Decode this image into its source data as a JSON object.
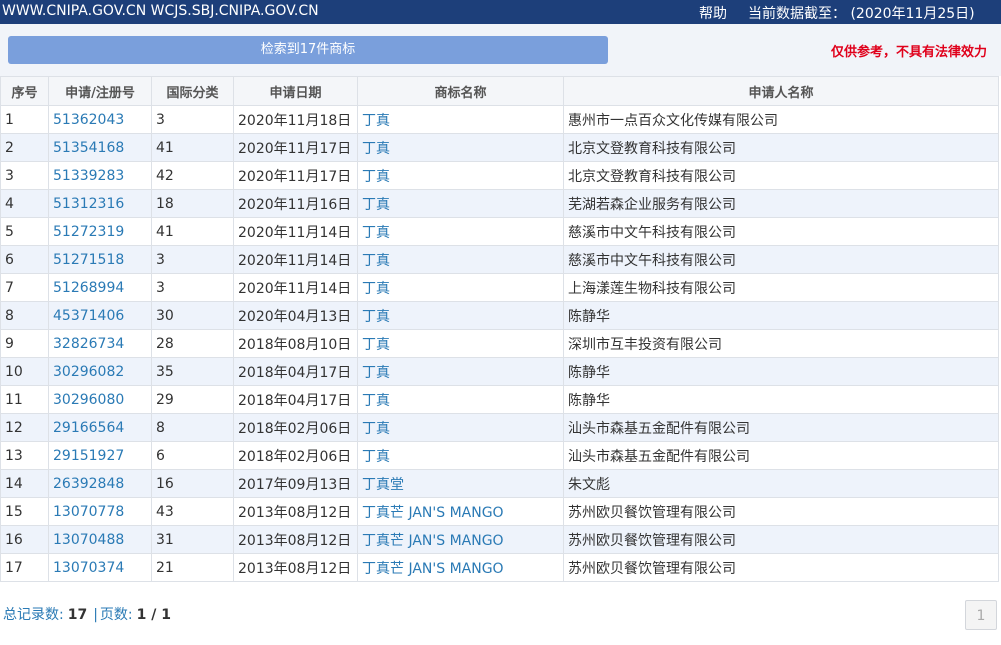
{
  "topbar": {
    "domains": "WWW.CNIPA.GOV.CN WCJS.SBJ.CNIPA.GOV.CN",
    "help": "帮助",
    "data_as_of": "当前数据截至： (2020年11月25日)"
  },
  "search": {
    "result_label": "检索到17件商标",
    "disclaimer": "仅供参考，不具有法律效力"
  },
  "table": {
    "headers": [
      "序号",
      "申请/注册号",
      "国际分类",
      "申请日期",
      "商标名称",
      "申请人名称"
    ],
    "rows": [
      {
        "no": "1",
        "reg": "51362043",
        "cls": "3",
        "date": "2020年11月18日",
        "mark": "丁真",
        "applicant": "惠州市一点百众文化传媒有限公司"
      },
      {
        "no": "2",
        "reg": "51354168",
        "cls": "41",
        "date": "2020年11月17日",
        "mark": "丁真",
        "applicant": "北京文登教育科技有限公司"
      },
      {
        "no": "3",
        "reg": "51339283",
        "cls": "42",
        "date": "2020年11月17日",
        "mark": "丁真",
        "applicant": "北京文登教育科技有限公司"
      },
      {
        "no": "4",
        "reg": "51312316",
        "cls": "18",
        "date": "2020年11月16日",
        "mark": "丁真",
        "applicant": "芜湖若森企业服务有限公司"
      },
      {
        "no": "5",
        "reg": "51272319",
        "cls": "41",
        "date": "2020年11月14日",
        "mark": "丁真",
        "applicant": "慈溪市中文午科技有限公司"
      },
      {
        "no": "6",
        "reg": "51271518",
        "cls": "3",
        "date": "2020年11月14日",
        "mark": "丁真",
        "applicant": "慈溪市中文午科技有限公司"
      },
      {
        "no": "7",
        "reg": "51268994",
        "cls": "3",
        "date": "2020年11月14日",
        "mark": "丁真",
        "applicant": "上海漾莲生物科技有限公司"
      },
      {
        "no": "8",
        "reg": "45371406",
        "cls": "30",
        "date": "2020年04月13日",
        "mark": "丁真",
        "applicant": "陈静华"
      },
      {
        "no": "9",
        "reg": "32826734",
        "cls": "28",
        "date": "2018年08月10日",
        "mark": "丁真",
        "applicant": "深圳市互丰投资有限公司"
      },
      {
        "no": "10",
        "reg": "30296082",
        "cls": "35",
        "date": "2018年04月17日",
        "mark": "丁真",
        "applicant": "陈静华"
      },
      {
        "no": "11",
        "reg": "30296080",
        "cls": "29",
        "date": "2018年04月17日",
        "mark": "丁真",
        "applicant": "陈静华"
      },
      {
        "no": "12",
        "reg": "29166564",
        "cls": "8",
        "date": "2018年02月06日",
        "mark": "丁真",
        "applicant": "汕头市森基五金配件有限公司"
      },
      {
        "no": "13",
        "reg": "29151927",
        "cls": "6",
        "date": "2018年02月06日",
        "mark": "丁真",
        "applicant": "汕头市森基五金配件有限公司"
      },
      {
        "no": "14",
        "reg": "26392848",
        "cls": "16",
        "date": "2017年09月13日",
        "mark": "丁真堂",
        "applicant": "朱文彪"
      },
      {
        "no": "15",
        "reg": "13070778",
        "cls": "43",
        "date": "2013年08月12日",
        "mark": "丁真芒 JAN'S MANGO",
        "applicant": "苏州欧贝餐饮管理有限公司"
      },
      {
        "no": "16",
        "reg": "13070488",
        "cls": "31",
        "date": "2013年08月12日",
        "mark": "丁真芒 JAN'S MANGO",
        "applicant": "苏州欧贝餐饮管理有限公司"
      },
      {
        "no": "17",
        "reg": "13070374",
        "cls": "21",
        "date": "2013年08月12日",
        "mark": "丁真芒 JAN'S MANGO",
        "applicant": "苏州欧贝餐饮管理有限公司"
      }
    ]
  },
  "footer": {
    "total_label": "总记录数:",
    "total_value": "17",
    "separator": "|",
    "pages_label": "页数:",
    "pages_value": "1 / 1",
    "page_button": "1"
  },
  "colors": {
    "topbar": "#1d3f7a",
    "result_bar": "#7a9fdc",
    "disclaimer": "#e0001b",
    "link": "#2a7ab5",
    "row_alt": "#eef3fb"
  }
}
